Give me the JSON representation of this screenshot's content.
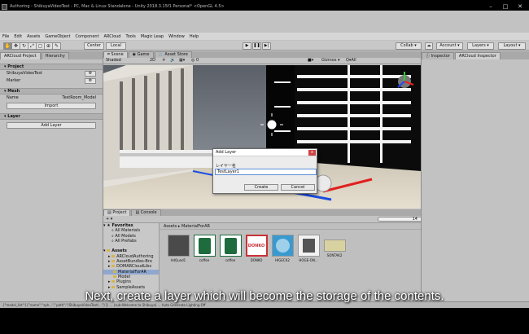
{
  "window": {
    "title": "Authoring - ShibuyaVideoTest - PC, Mac & Linux Standalone - Unity 2018.3.15f1 Personal* <OpenGL 4.5>",
    "controls": [
      "–",
      "□",
      "✕"
    ]
  },
  "menu": [
    "File",
    "Edit",
    "Assets",
    "GameObject",
    "Component",
    "ARCloud",
    "Tools",
    "Magic Leap",
    "Window",
    "Help"
  ],
  "toolbar": {
    "pivot_label": "Center",
    "space_label": "Local",
    "play_icons": [
      "▶",
      "❚❚",
      "▶|"
    ],
    "collab_label": "Collab ▾",
    "account_label": "Account ▾",
    "layers_label": "Layers ▾",
    "layout_label": "Layout ▾"
  },
  "left_panel": {
    "tabs": [
      "ARCloud Project",
      "Hierarchy"
    ],
    "project_header": "Project",
    "project_items": [
      {
        "name": "ShibuyaVideoTest"
      },
      {
        "name": "Marker"
      }
    ],
    "mesh_header": "Mesh",
    "mesh_name_label": "Name",
    "mesh_name_value": "TestRoom_Model",
    "import_button": "Import",
    "layer_header": "Layer",
    "add_layer_button": "Add Layer"
  },
  "scene": {
    "tabs": [
      "Scene",
      "Game",
      "Asset Store"
    ],
    "shading": "Shaded",
    "mode_2d": "2D",
    "gizmos": "Gizmos ▾",
    "search_placeholder": "All"
  },
  "dialog": {
    "title": "Add Layer",
    "label": "レイヤー名",
    "input_value": "TestLayer1",
    "create_label": "Create",
    "cancel_label": "Cancel",
    "close_icon": "x"
  },
  "project": {
    "tabs": [
      "Project",
      "Console"
    ],
    "create_label": "+ ▾",
    "tree": [
      {
        "label": "Favorites",
        "bold": true
      },
      {
        "label": "All Materials"
      },
      {
        "label": "All Models"
      },
      {
        "label": "All Prefabs"
      },
      {
        "label": ""
      },
      {
        "label": "Assets",
        "bold": true
      },
      {
        "label": "ARCloudAuthoring"
      },
      {
        "label": "AssetBundles-Bro"
      },
      {
        "label": "DOMARCloudLibs"
      },
      {
        "label": "MaterialForAR",
        "selected": true
      },
      {
        "label": "Model"
      },
      {
        "label": "Plugins"
      },
      {
        "label": "SampleAssets"
      }
    ],
    "breadcrumb": "Assets ▸ MaterialForAR",
    "slider_value": "14",
    "assets": [
      {
        "label": "AdQuad1",
        "color": "#4a4a4a"
      },
      {
        "label": "coffee",
        "color": "#1e6b3e"
      },
      {
        "label": "coffee",
        "color": "#1e6b3e"
      },
      {
        "label": "DONKO",
        "color": "#c8323a"
      },
      {
        "label": "HIGECK2",
        "color": "#3a9ad0"
      },
      {
        "label": "HOGE-ON...",
        "color": "#f2f2f2"
      },
      {
        "label": "SONTAK2",
        "color": "#d8d2a0"
      }
    ]
  },
  "right_panel": {
    "tabs": [
      "Inspector",
      "ARCloud Inspector"
    ]
  },
  "status": {
    "text": "{\"model_list\":[{\"name\":\"sph...\",\"path\":\"/ShibuyaVideoTest/...\"}]} ... (sub:Welcome to Shibuya) ... Auto Generate Lighting Off"
  },
  "subtitle": "Next, create a layer which will become the storage of the contents."
}
